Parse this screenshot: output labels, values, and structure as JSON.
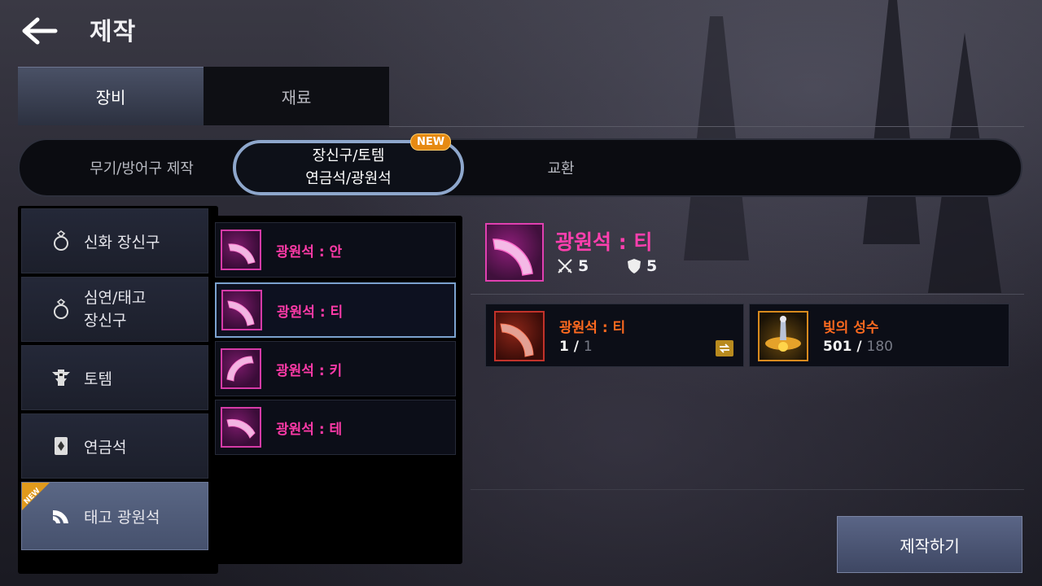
{
  "header": {
    "title": "제작"
  },
  "main_tabs": [
    {
      "label": "장비",
      "active": true
    },
    {
      "label": "재료",
      "active": false
    }
  ],
  "sub_tabs": [
    {
      "label": "무기/방어구 제작"
    },
    {
      "line1": "장신구/토템",
      "line2": "연금석/광원석",
      "active": true,
      "badge": "NEW"
    },
    {
      "label": "교환"
    }
  ],
  "categories": [
    {
      "label": "신화 장신구",
      "icon": "ring-icon"
    },
    {
      "line1": "심연/태고",
      "line2": "장신구",
      "icon": "ring-icon"
    },
    {
      "label": "토템",
      "icon": "totem-icon"
    },
    {
      "label": "연금석",
      "icon": "alchemy-stone-icon"
    },
    {
      "label": "태고 광원석",
      "icon": "light-stone-icon",
      "active": true,
      "badge": "NEW"
    }
  ],
  "items": [
    {
      "name": "광원석 : 안"
    },
    {
      "name": "광원석 : 티",
      "selected": true
    },
    {
      "name": "광원석 : 키"
    },
    {
      "name": "광원석 : 테"
    }
  ],
  "detail": {
    "name": "광원석 : 티",
    "attack": "5",
    "defense": "5"
  },
  "materials": [
    {
      "name": "광원석 : 티",
      "have": "1 / ",
      "need": "1"
    },
    {
      "name": "빛의 성수",
      "have": "501 / ",
      "need": "180"
    }
  ],
  "craft_button": {
    "label": "제작하기"
  },
  "colors": {
    "item_name": "#ff3aa8",
    "material_name": "#ff6a1f",
    "selected_border": "#7ba2cf",
    "badge": "#e68a12"
  }
}
